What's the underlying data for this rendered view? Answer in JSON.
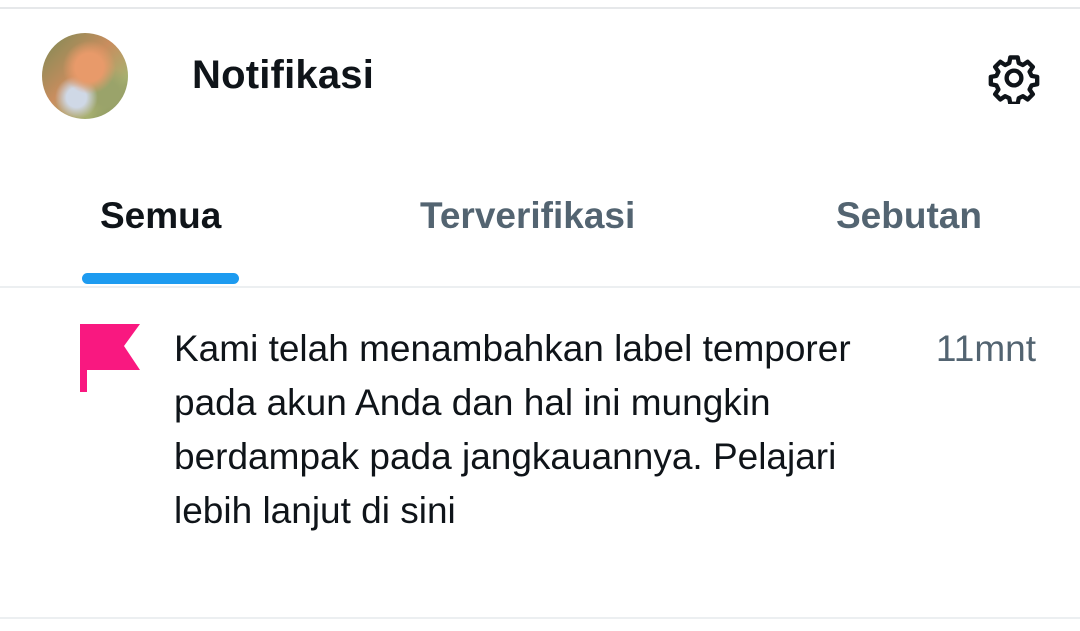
{
  "header": {
    "title": "Notifikasi",
    "avatar_icon": "profile-avatar",
    "settings_icon": "gear-icon"
  },
  "tabs": [
    {
      "label": "Semua",
      "active": true
    },
    {
      "label": "Terverifikasi",
      "active": false
    },
    {
      "label": "Sebutan",
      "active": false
    }
  ],
  "notifications": [
    {
      "icon": "flag-icon",
      "text": "Kami telah menambahkan label temporer pada akun Anda dan hal ini mungkin berdampak pada jangkauannya. Pelajari lebih lanjut di sini",
      "time": "11mnt"
    }
  ],
  "colors": {
    "accent": "#1d9bf0",
    "flag": "#f91880",
    "text_primary": "#0f1419",
    "text_secondary": "#536471"
  }
}
